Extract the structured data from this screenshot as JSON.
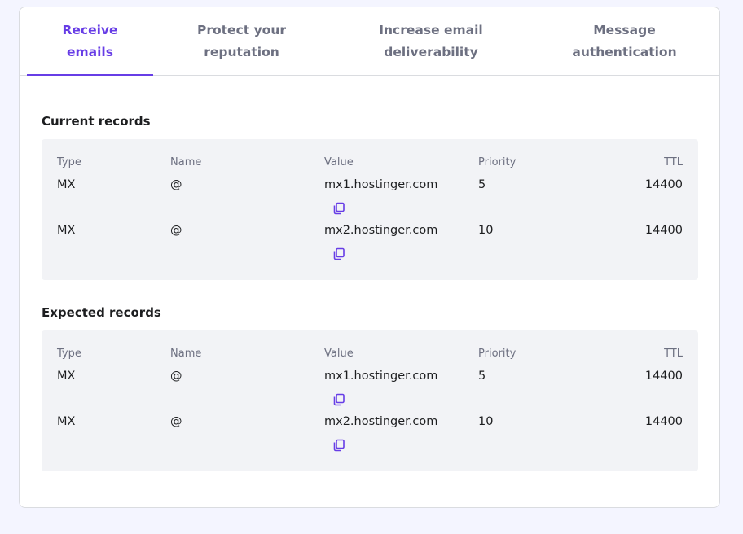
{
  "colors": {
    "accent": "#673de6",
    "panel": "#f2f3f6",
    "muted": "#6d7081"
  },
  "tabs": [
    {
      "line1": "Receive",
      "line2": "emails"
    },
    {
      "line1": "Protect your",
      "line2": "reputation"
    },
    {
      "line1": "Increase email",
      "line2": "deliverability"
    },
    {
      "line1": "Message",
      "line2": "authentication"
    }
  ],
  "current": {
    "title": "Current records",
    "headers": {
      "type": "Type",
      "name": "Name",
      "value": "Value",
      "priority": "Priority",
      "ttl": "TTL"
    },
    "rows": [
      {
        "type": "MX",
        "name": "@",
        "value": "mx1.hostinger.com",
        "priority": "5",
        "ttl": "14400",
        "icon": "copy-icon"
      },
      {
        "type": "MX",
        "name": "@",
        "value": "mx2.hostinger.com",
        "priority": "10",
        "ttl": "14400",
        "icon": "copy-icon"
      }
    ]
  },
  "expected": {
    "title": "Expected records",
    "headers": {
      "type": "Type",
      "name": "Name",
      "value": "Value",
      "priority": "Priority",
      "ttl": "TTL"
    },
    "rows": [
      {
        "type": "MX",
        "name": "@",
        "value": "mx1.hostinger.com",
        "priority": "5",
        "ttl": "14400",
        "icon": "copy-icon"
      },
      {
        "type": "MX",
        "name": "@",
        "value": "mx2.hostinger.com",
        "priority": "10",
        "ttl": "14400",
        "icon": "copy-icon"
      }
    ]
  }
}
